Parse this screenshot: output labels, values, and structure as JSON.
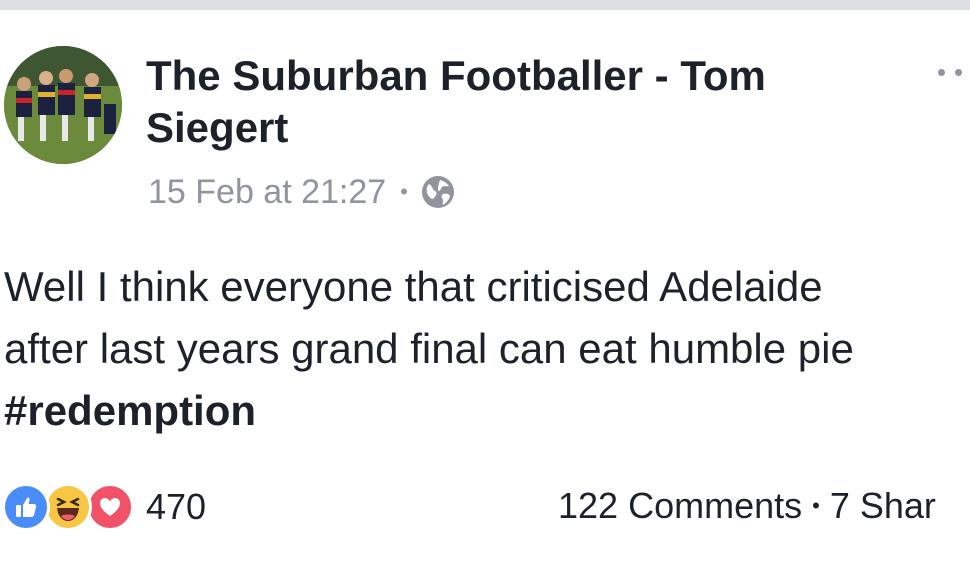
{
  "post": {
    "author": "The Suburban Footballer - Tom Siegert",
    "timestamp": "15 Feb at 21:27",
    "audience_icon": "globe-icon",
    "text_lines": [
      "Well I think everyone that criticised Adelaide",
      "after last years grand final can eat humble pie"
    ],
    "hashtag": "#redemption"
  },
  "reactions": {
    "icons": [
      "like-icon",
      "haha-icon",
      "love-icon"
    ],
    "count": "470"
  },
  "stats": {
    "comments": "122 Comments",
    "shares": "7 Shar"
  },
  "colors": {
    "text_primary": "#1d2129",
    "text_secondary": "#90949c",
    "like_blue": "#4a8df8",
    "haha_yellow": "#f7c645",
    "love_red": "#f25268"
  }
}
